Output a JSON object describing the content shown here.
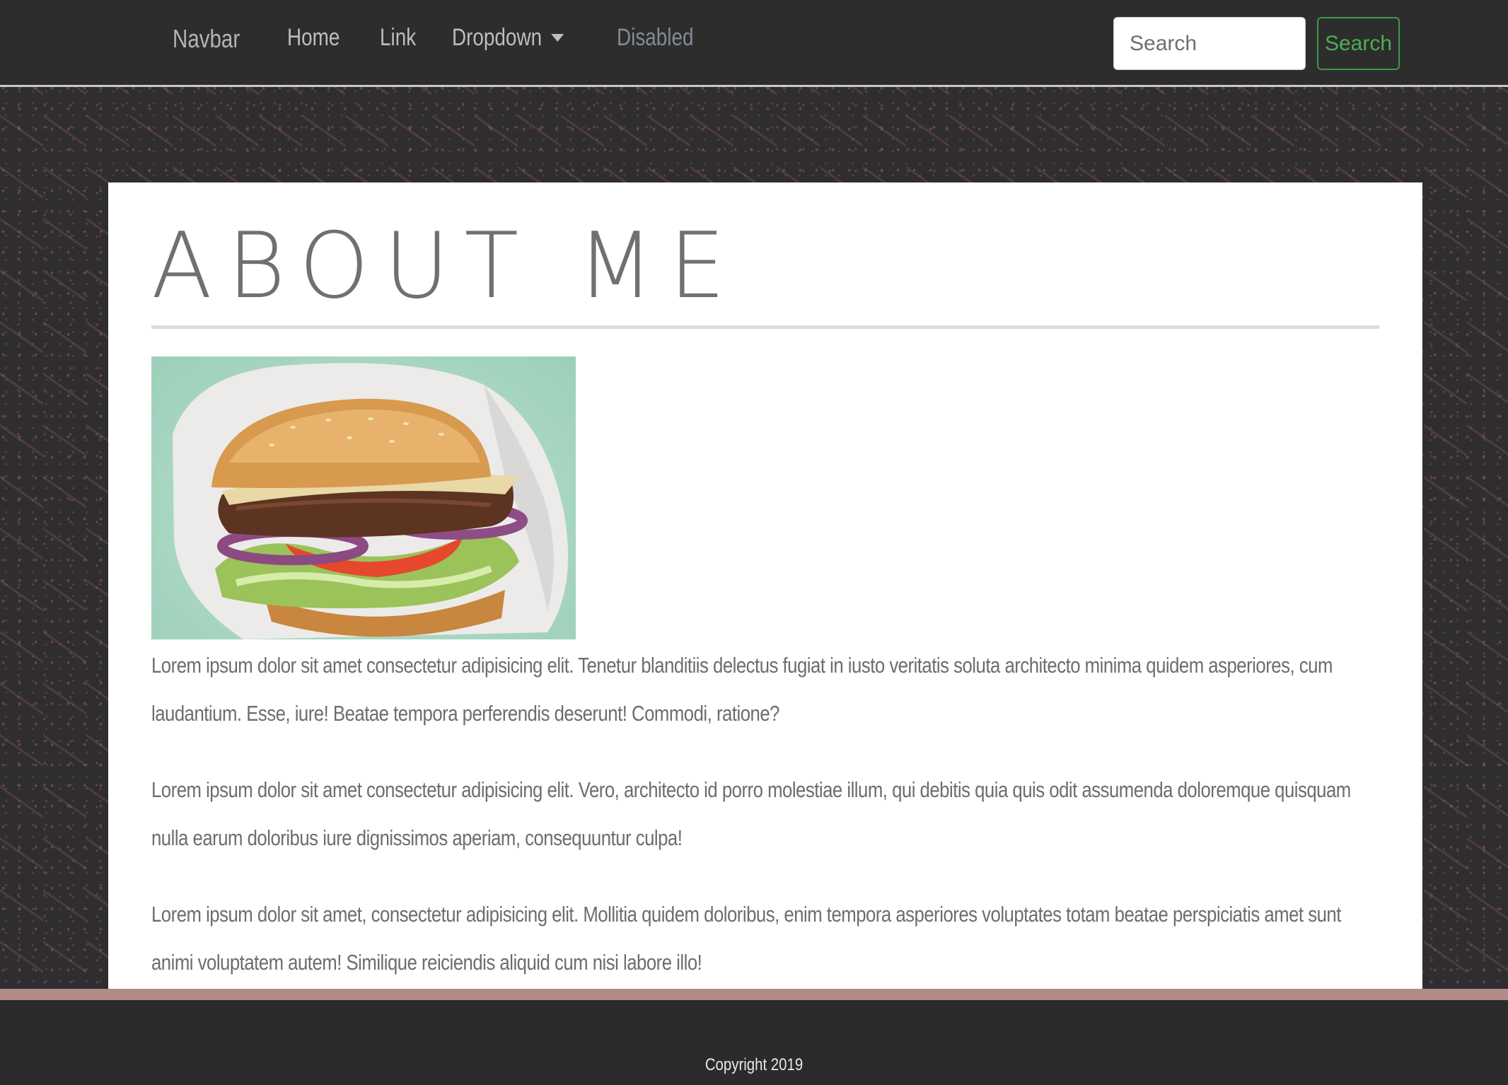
{
  "navbar": {
    "brand": "Navbar",
    "links": [
      "Home",
      "Link",
      "Dropdown",
      "Disabled"
    ],
    "search_placeholder": "Search",
    "search_button": "Search"
  },
  "main": {
    "title": "ABOUT ME",
    "image_alt": "burger-photo",
    "paragraphs": [
      "Lorem ipsum dolor sit amet consectetur adipisicing elit. Tenetur blanditiis delectus fugiat in iusto veritatis soluta architecto minima quidem asperiores, cum laudantium. Esse, iure! Beatae tempora perferendis deserunt! Commodi, ratione?",
      "Lorem ipsum dolor sit amet consectetur adipisicing elit. Vero, architecto id porro molestiae illum, qui debitis quia quis odit assumenda doloremque quisquam nulla earum doloribus iure dignissimos aperiam, consequuntur culpa!",
      "Lorem ipsum dolor sit amet, consectetur adipisicing elit. Mollitia quidem doloribus, enim tempora asperiores voluptates totam beatae perspiciatis amet sunt animi voluptatem autem! Similique reiciendis aliquid cum nisi labore illo!"
    ]
  },
  "footer": {
    "copyright": "Copyright 2019"
  },
  "colors": {
    "navbar_bg": "#2d2d2e",
    "accent_green": "#4caf50",
    "footer_stripe": "#b48a89",
    "text_gray": "#6d6d6d"
  }
}
